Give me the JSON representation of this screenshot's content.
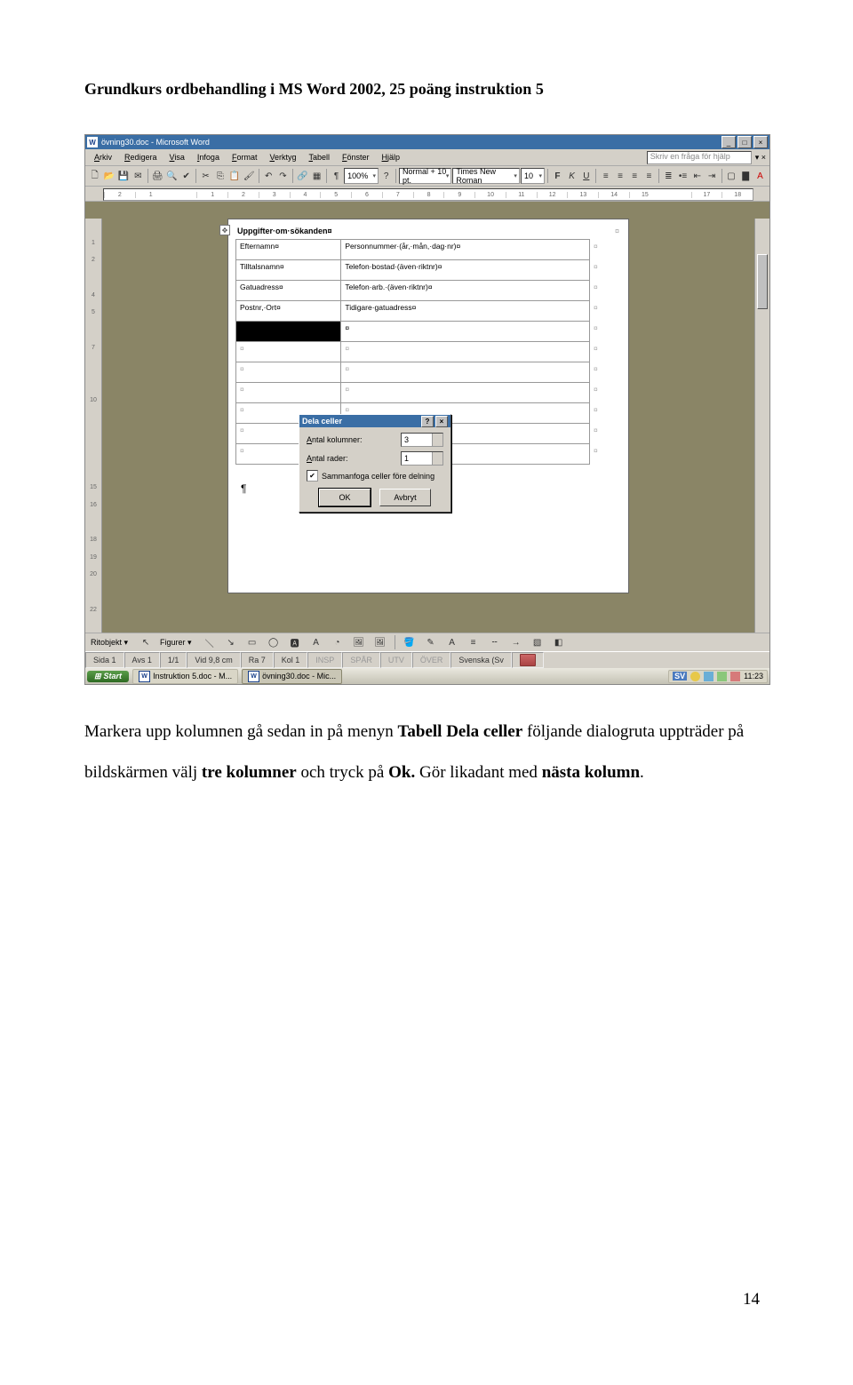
{
  "doc_header": "Grundkurs ordbehandling i MS Word 2002, 25 poäng instruktion 5",
  "word": {
    "title": "övning30.doc - Microsoft Word",
    "menus": [
      "Arkiv",
      "Redigera",
      "Visa",
      "Infoga",
      "Format",
      "Verktyg",
      "Tabell",
      "Fönster",
      "Hjälp"
    ],
    "help_placeholder": "Skriv en fråga för hjälp",
    "zoom": "100%",
    "style": "Normal + 10 pt.",
    "font": "Times New Roman",
    "font_size": "10",
    "ruler_ticks": [
      "2",
      "1",
      "",
      "1",
      "2",
      "3",
      "4",
      "5",
      "6",
      "7",
      "8",
      "9",
      "10",
      "11",
      "12",
      "13",
      "14",
      "15",
      "",
      "17",
      "18"
    ],
    "vruler": [
      "",
      "1",
      "2",
      "",
      "4",
      "5",
      "",
      "7",
      "",
      "",
      "10",
      "",
      "",
      "",
      "",
      "15",
      "16",
      "",
      "18",
      "19",
      "20",
      "",
      "22",
      ""
    ],
    "paper_heading": "Uppgifter·om·sökanden¤",
    "rows": [
      {
        "l": "Efternamn¤",
        "r": "Personnummer·(år,·mån,·dag·nr)¤"
      },
      {
        "l": "Tilltalsnamn¤",
        "r": "Telefon·bostad·(även·riktnr)¤"
      },
      {
        "l": "Gatuadress¤",
        "r": "Telefon·arb.·(även·riktnr)¤"
      },
      {
        "l": "Postnr,·Ort¤",
        "r": "Tidigare·gatuadress¤"
      }
    ],
    "blank_rows": 6,
    "dialog": {
      "title": "Dela celler",
      "cols_label": "Antal kolumner:",
      "rows_label": "Antal rader:",
      "cols_value": "3",
      "rows_value": "1",
      "merge_label": "Sammanfoga celler före delning",
      "ok": "OK",
      "cancel": "Avbryt"
    },
    "draw": {
      "ritobjekt": "Ritobjekt ▾",
      "figurer": "Figurer ▾"
    },
    "status": {
      "sida": "Sida 1",
      "avs": "Avs 1",
      "pages": "1/1",
      "vid": "Vid 9,8 cm",
      "ra": "Ra 7",
      "kol": "Kol 1",
      "insp": "INSP",
      "spar": "SPÅR",
      "utv": "UTV",
      "over": "ÖVER",
      "lang": "Svenska (Sv"
    },
    "taskbar": {
      "start": "Start",
      "task1": "Instruktion 5.doc - M...",
      "task2": "övning30.doc - Mic...",
      "lang_ind": "SV",
      "clock": "11:23"
    }
  },
  "body_text": {
    "p": "Markera upp kolumnen gå sedan in på menyn Tabell Dela celler följande dialogruta uppträder på bildskärmen välj tre kolumner och tryck på Ok. Gör likadant med nästa kolumn."
  },
  "page_number": "14"
}
